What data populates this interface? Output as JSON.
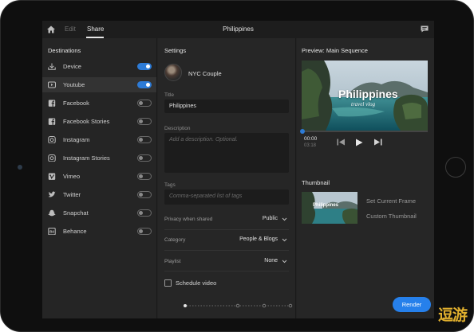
{
  "header": {
    "edit_tab": "Edit",
    "share_tab": "Share",
    "project_title": "Philippines"
  },
  "destinations": {
    "heading": "Destinations",
    "items": [
      {
        "label": "Device",
        "icon": "download-icon",
        "enabled": true
      },
      {
        "label": "Youtube",
        "icon": "youtube-icon",
        "enabled": true
      },
      {
        "label": "Facebook",
        "icon": "facebook-icon",
        "enabled": false
      },
      {
        "label": "Facebook Stories",
        "icon": "facebook-icon",
        "enabled": false
      },
      {
        "label": "Instagram",
        "icon": "instagram-icon",
        "enabled": false
      },
      {
        "label": "Instagram Stories",
        "icon": "instagram-icon",
        "enabled": false
      },
      {
        "label": "Vimeo",
        "icon": "vimeo-icon",
        "enabled": false
      },
      {
        "label": "Twitter",
        "icon": "twitter-icon",
        "enabled": false
      },
      {
        "label": "Snapchat",
        "icon": "snapchat-icon",
        "enabled": false
      },
      {
        "label": "Behance",
        "icon": "behance-icon",
        "enabled": false
      }
    ]
  },
  "settings": {
    "heading": "Settings",
    "account_name": "NYC Couple",
    "title_label": "Title",
    "title_value": "Philippines",
    "description_label": "Description",
    "description_placeholder": "Add a description. Optional.",
    "tags_label": "Tags",
    "tags_placeholder": "Comma-separated list of tags",
    "privacy_label": "Privacy when shared",
    "privacy_value": "Public",
    "category_label": "Category",
    "category_value": "People & Blogs",
    "playlist_label": "Playlist",
    "playlist_value": "None",
    "schedule_label": "Schedule video",
    "schedule_checked": false
  },
  "preview": {
    "heading": "Preview: Main Sequence",
    "video_title": "Philippines",
    "video_subtitle": "travel vlog",
    "timecode_current": "00:00",
    "timecode_total": "03:18",
    "playhead_fraction": 0.0
  },
  "thumbnail": {
    "heading": "Thumbnail",
    "image_title": "Philippines",
    "set_current_frame": "Set Current Frame",
    "custom_thumbnail": "Custom Thumbnail"
  },
  "footer": {
    "render_label": "Render",
    "page_count": 4,
    "current_page": 1
  },
  "watermark": "逗游",
  "colors": {
    "accent": "#2680eb",
    "toggle_on": "#2d7bd6",
    "panel_bg": "#262626",
    "watermark": "#e0af2e"
  }
}
